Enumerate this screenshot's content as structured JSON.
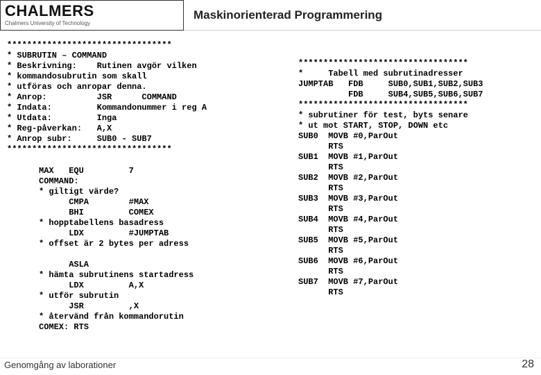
{
  "header": {
    "logo_main": "CHALMERS",
    "logo_sub": "Chalmers University of Technology",
    "title": "Maskinorienterad Programmering"
  },
  "left": {
    "block1": "*********************************\n* SUBRUTIN – COMMAND\n* Beskrivning:    Rutinen avgör vilken\n* kommandosubrutin som skall\n* utföras och anropar denna.\n* Anrop:          JSR      COMMAND\n* Indata:         Kommandonummer i reg A\n* Utdata:         Inga\n* Reg-påverkan:   A,X\n* Anrop subr:     SUB0 - SUB7\n*********************************",
    "block2": "MAX   EQU         7\nCOMMAND:\n* giltigt värde?\n      CMPA        #MAX\n      BHI         COMEX\n* hopptabellens basadress\n      LDX         #JUMPTAB\n* offset är 2 bytes per adress\n\n      ASLA\n* hämta subrutinens startadress\n      LDX         A,X\n* utför subrutin\n      JSR         ,X\n* återvänd från kommandorutin\nCOMEX: RTS"
  },
  "right": {
    "block": "**********************************\n*     Tabell med subrutinadresser\nJUMPTAB   FDB     SUB0,SUB1,SUB2,SUB3\n          FDB     SUB4,SUB5,SUB6,SUB7\n**********************************\n* subrutiner för test, byts senare\n* ut mot START, STOP, DOWN etc\nSUB0  MOVB #0,ParOut\n      RTS\nSUB1  MOVB #1,ParOut\n      RTS\nSUB2  MOVB #2,ParOut\n      RTS\nSUB3  MOVB #3,ParOut\n      RTS\nSUB4  MOVB #4,ParOut\n      RTS\nSUB5  MOVB #5,ParOut\n      RTS\nSUB6  MOVB #6,ParOut\n      RTS\nSUB7  MOVB #7,ParOut\n      RTS"
  },
  "footer": {
    "left": "Genomgång av laborationer",
    "page": "28"
  }
}
